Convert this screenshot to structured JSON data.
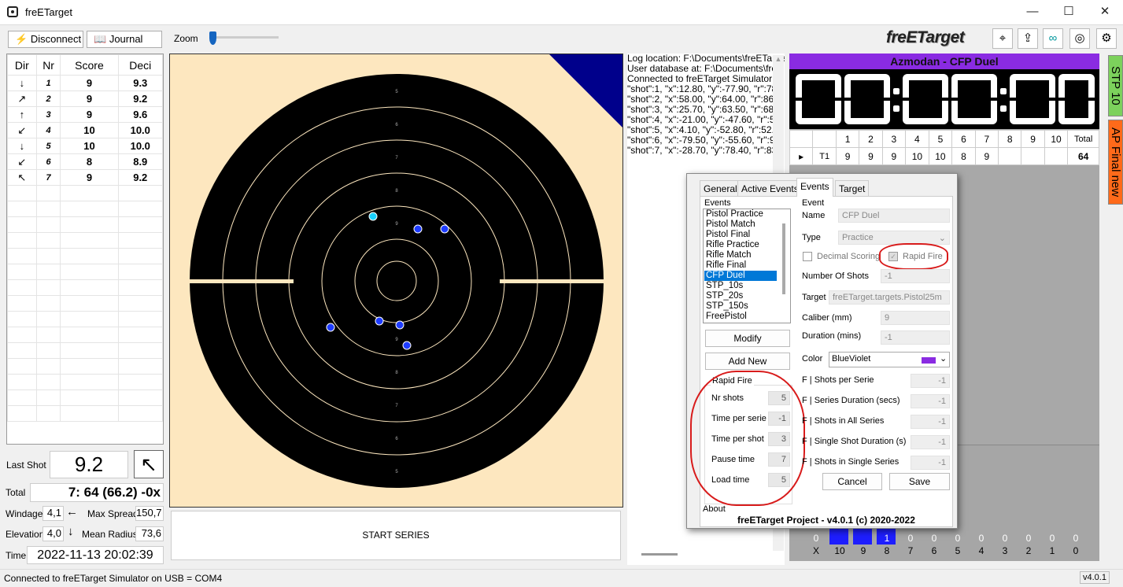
{
  "window": {
    "title": "freETarget",
    "controls": [
      "—",
      "☐",
      "✕"
    ]
  },
  "toolbar": {
    "disconnect": "Disconnect",
    "journal": "Journal",
    "zoom": "Zoom",
    "logo": "freETarget"
  },
  "shots": {
    "headers": [
      "Dir",
      "Nr",
      "Score",
      "Deci"
    ],
    "rows": [
      {
        "dir": "↓",
        "nr": "1",
        "score": "9",
        "deci": "9.3"
      },
      {
        "dir": "↗",
        "nr": "2",
        "score": "9",
        "deci": "9.2"
      },
      {
        "dir": "↑",
        "nr": "3",
        "score": "9",
        "deci": "9.6"
      },
      {
        "dir": "↙",
        "nr": "4",
        "score": "10",
        "deci": "10.0"
      },
      {
        "dir": "↓",
        "nr": "5",
        "score": "10",
        "deci": "10.0"
      },
      {
        "dir": "↙",
        "nr": "6",
        "score": "8",
        "deci": "8.9"
      },
      {
        "dir": "↖",
        "nr": "7",
        "score": "9",
        "deci": "9.2"
      }
    ]
  },
  "stats": {
    "last_shot_label": "Last Shot",
    "last_shot": "9.2",
    "total_label": "Total",
    "total": "7: 64 (66.2) -0x",
    "windage_label": "Windage",
    "windage": "4,1",
    "windage_arrow": "←",
    "max_spread_label": "Max Spread",
    "max_spread": "150,7",
    "elevation_label": "Elevation",
    "elevation": "4,0",
    "elevation_arrow": "↓",
    "mean_radius_label": "Mean Radius",
    "mean_radius": "73,6",
    "time_label": "Time",
    "time": "2022-11-13  20:02:39"
  },
  "start_series": "START SERIES",
  "ring_labels": [
    "5",
    "6",
    "7",
    "8",
    "9",
    "9",
    "8",
    "7",
    "6",
    "5"
  ],
  "log": [
    "Log location: F:\\Documents\\freETarge",
    "User database at: F:\\Documents\\freE",
    "Connected to freETarget Simulator",
    "\"shot\":1, \"x\":12.80, \"y\":-77.90, \"r\":78.",
    "\"shot\":2, \"x\":58.00, \"y\":64.00, \"r\":86.3",
    "\"shot\":3, \"x\":25.70, \"y\":63.50, \"r\":68.5",
    "\"shot\":4, \"x\":-21.00, \"y\":-47.60, \"r\":52",
    "\"shot\":5, \"x\":4.10, \"y\":-52.80, \"r\":52.9",
    "\"shot\":6, \"x\":-79.50, \"y\":-55.60, \"r\":97",
    "\"shot\":7, \"x\":-28.70, \"y\":78.40, \"r\":83."
  ],
  "event_banner": "Azmodan - CFP Duel",
  "series": {
    "headers": [
      "1",
      "2",
      "3",
      "4",
      "5",
      "6",
      "7",
      "8",
      "9",
      "10",
      "Total"
    ],
    "row_label": "T1",
    "values": [
      "9",
      "9",
      "9",
      "10",
      "10",
      "8",
      "9",
      "",
      "",
      "",
      ""
    ],
    "total": "64"
  },
  "side_tabs": [
    "STP 10",
    "AP Final new"
  ],
  "histogram": {
    "counts": [
      "0",
      "",
      "",
      "1",
      "0",
      "0",
      "0",
      "0",
      "0",
      "0",
      "0"
    ],
    "labels": [
      "X",
      "10",
      "9",
      "8",
      "7",
      "6",
      "5",
      "4",
      "3",
      "2",
      "1",
      "0"
    ],
    "counts_full": [
      "0",
      "",
      "",
      "1",
      "0",
      "0",
      "0",
      "0",
      "0",
      "0",
      "0",
      "0"
    ]
  },
  "dialog": {
    "tabs": [
      "General",
      "Active Events",
      "Events",
      "Target"
    ],
    "events_label": "Events",
    "events": [
      "Pistol Practice",
      "Pistol Match",
      "Pistol Final",
      "Rifle Practice",
      "Rifle Match",
      "Rifle Final",
      "CFP Duel",
      "STP_10s",
      "STP_20s",
      "STP_150s",
      "FreePistol"
    ],
    "selected_event": "CFP Duel",
    "modify": "Modify",
    "add_new": "Add New",
    "rapid_fire_group": "Rapid Fire",
    "rapid": [
      {
        "label": "Nr shots",
        "value": "5"
      },
      {
        "label": "Time per serie",
        "value": "-1"
      },
      {
        "label": "Time per shot",
        "value": "3"
      },
      {
        "label": "Pause time",
        "value": "7"
      },
      {
        "label": "Load time",
        "value": "5"
      }
    ],
    "event_group": "Event",
    "name_label": "Name",
    "name": "CFP Duel",
    "type_label": "Type",
    "type": "Practice",
    "decimal_scoring": "Decimal Scoring",
    "rapid_fire": "Rapid Fire",
    "num_shots_label": "Number Of Shots",
    "num_shots": "-1",
    "target_label": "Target",
    "target": "freETarget.targets.Pistol25m",
    "caliber_label": "Caliber (mm)",
    "caliber": "9",
    "duration_label": "Duration (mins)",
    "duration": "-1",
    "color_label": "Color",
    "color": "BlueViolet",
    "color_hex": "#8a2be2",
    "f_fields": [
      {
        "label": "F | Shots per Serie",
        "value": "-1"
      },
      {
        "label": "F | Series Duration (secs)",
        "value": "-1"
      },
      {
        "label": "F | Shots in All Series",
        "value": "-1"
      },
      {
        "label": "F | Single Shot Duration (s)",
        "value": "-1"
      },
      {
        "label": "F | Shots in Single Series",
        "value": "-1"
      }
    ],
    "cancel": "Cancel",
    "save": "Save",
    "about_label": "About",
    "about": "freETarget Project  -  v4.0.1   (c) 2020-2022"
  },
  "status": {
    "text": "Connected to freETarget Simulator on USB = COM4",
    "version": "v4.0.1"
  }
}
